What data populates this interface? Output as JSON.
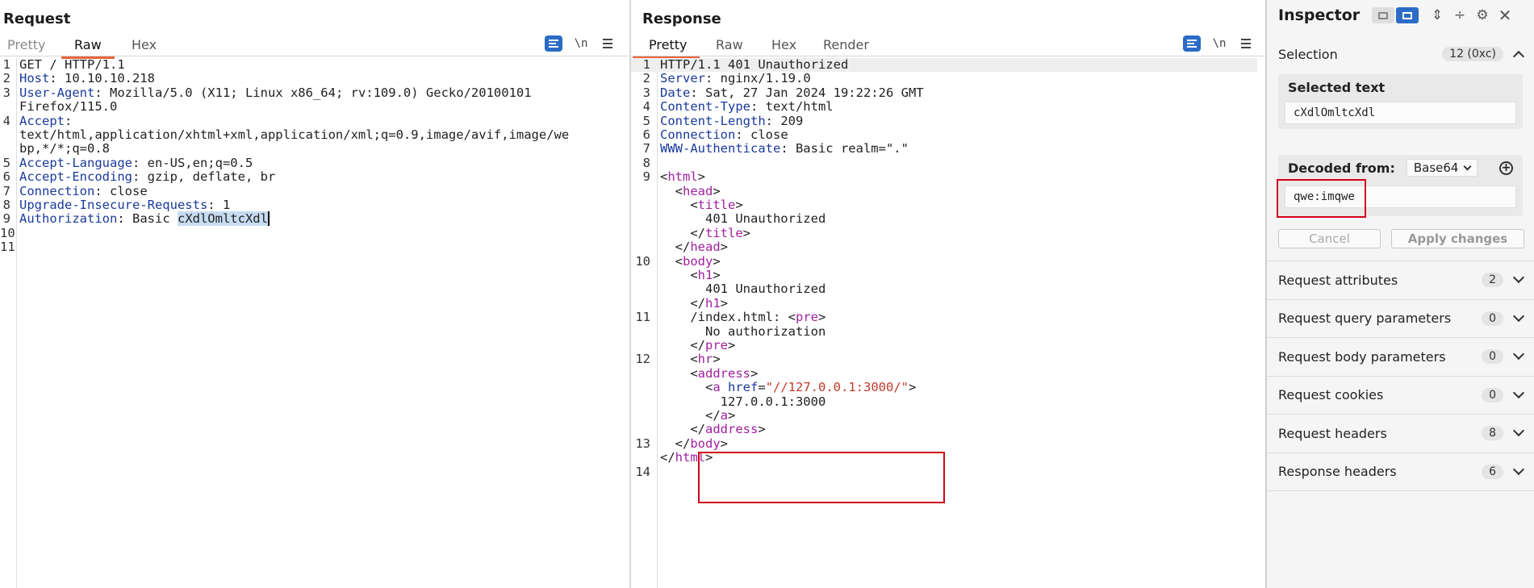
{
  "request": {
    "title": "Request",
    "tabs": [
      "Pretty",
      "Raw",
      "Hex"
    ],
    "active_tab": "Raw",
    "newline_toggle": "\\n",
    "lines": [
      {
        "n": "1",
        "key": "",
        "val": "GET / HTTP/1.1"
      },
      {
        "n": "2",
        "key": "Host",
        "val": ": 10.10.10.218"
      },
      {
        "n": "3",
        "key": "User-Agent",
        "val": ": Mozilla/5.0 (X11; Linux x86_64; rv:109.0) Gecko/20100101"
      },
      {
        "n": "",
        "key": "",
        "val": "Firefox/115.0"
      },
      {
        "n": "4",
        "key": "Accept",
        "val": ":"
      },
      {
        "n": "",
        "key": "",
        "val": "text/html,application/xhtml+xml,application/xml;q=0.9,image/avif,image/we"
      },
      {
        "n": "",
        "key": "",
        "val": "bp,*/*;q=0.8"
      },
      {
        "n": "5",
        "key": "Accept-Language",
        "val": ": en-US,en;q=0.5"
      },
      {
        "n": "6",
        "key": "Accept-Encoding",
        "val": ": gzip, deflate, br"
      },
      {
        "n": "7",
        "key": "Connection",
        "val": ": close"
      },
      {
        "n": "8",
        "key": "Upgrade-Insecure-Requests",
        "val": ": 1"
      },
      {
        "n": "9",
        "key": "Authorization",
        "val": ": Basic ",
        "sel": "cXdlOmltcXdl"
      },
      {
        "n": "10",
        "key": "",
        "val": ""
      },
      {
        "n": "11",
        "key": "",
        "val": ""
      }
    ]
  },
  "response": {
    "title": "Response",
    "tabs": [
      "Pretty",
      "Raw",
      "Hex",
      "Render"
    ],
    "active_tab": "Pretty",
    "newline_toggle": "\\n",
    "lines": [
      {
        "n": "1",
        "parts": [
          [
            "t",
            "HTTP/1.1 401 Unauthorized"
          ]
        ],
        "hl": true
      },
      {
        "n": "2",
        "parts": [
          [
            "k",
            "Server"
          ],
          [
            "t",
            ": nginx/1.19.0"
          ]
        ]
      },
      {
        "n": "3",
        "parts": [
          [
            "k",
            "Date"
          ],
          [
            "t",
            ": Sat, 27 Jan 2024 19:22:26 GMT"
          ]
        ]
      },
      {
        "n": "4",
        "parts": [
          [
            "k",
            "Content-Type"
          ],
          [
            "t",
            ": text/html"
          ]
        ]
      },
      {
        "n": "5",
        "parts": [
          [
            "k",
            "Content-Length"
          ],
          [
            "t",
            ": 209"
          ]
        ]
      },
      {
        "n": "6",
        "parts": [
          [
            "k",
            "Connection"
          ],
          [
            "t",
            ": close"
          ]
        ]
      },
      {
        "n": "7",
        "parts": [
          [
            "k",
            "WWW-Authenticate"
          ],
          [
            "t",
            ": Basic realm=\".\""
          ]
        ]
      },
      {
        "n": "8",
        "parts": []
      },
      {
        "n": "9",
        "parts": [
          [
            "t",
            "<"
          ],
          [
            "g",
            "html"
          ],
          [
            "t",
            ">"
          ]
        ]
      },
      {
        "n": "",
        "parts": [
          [
            "t",
            "  <"
          ],
          [
            "g",
            "head"
          ],
          [
            "t",
            ">"
          ]
        ]
      },
      {
        "n": "",
        "parts": [
          [
            "t",
            "    <"
          ],
          [
            "g",
            "title"
          ],
          [
            "t",
            ">"
          ]
        ]
      },
      {
        "n": "",
        "parts": [
          [
            "t",
            "      401 Unauthorized"
          ]
        ]
      },
      {
        "n": "",
        "parts": [
          [
            "t",
            "    </"
          ],
          [
            "g",
            "title"
          ],
          [
            "t",
            ">"
          ]
        ]
      },
      {
        "n": "",
        "parts": [
          [
            "t",
            "  </"
          ],
          [
            "g",
            "head"
          ],
          [
            "t",
            ">"
          ]
        ]
      },
      {
        "n": "10",
        "parts": [
          [
            "t",
            "  <"
          ],
          [
            "g",
            "body"
          ],
          [
            "t",
            ">"
          ]
        ]
      },
      {
        "n": "",
        "parts": [
          [
            "t",
            "    <"
          ],
          [
            "g",
            "h1"
          ],
          [
            "t",
            ">"
          ]
        ]
      },
      {
        "n": "",
        "parts": [
          [
            "t",
            "      401 Unauthorized"
          ]
        ]
      },
      {
        "n": "",
        "parts": [
          [
            "t",
            "    </"
          ],
          [
            "g",
            "h1"
          ],
          [
            "t",
            ">"
          ]
        ]
      },
      {
        "n": "11",
        "parts": [
          [
            "t",
            "    /index.html: <"
          ],
          [
            "g",
            "pre"
          ],
          [
            "t",
            ">"
          ]
        ]
      },
      {
        "n": "",
        "parts": [
          [
            "t",
            "      No authorization"
          ]
        ]
      },
      {
        "n": "",
        "parts": [
          [
            "t",
            "    </"
          ],
          [
            "g",
            "pre"
          ],
          [
            "t",
            ">"
          ]
        ]
      },
      {
        "n": "12",
        "parts": [
          [
            "t",
            "    <"
          ],
          [
            "g",
            "hr"
          ],
          [
            "t",
            ">"
          ]
        ]
      },
      {
        "n": "",
        "parts": [
          [
            "t",
            "    <"
          ],
          [
            "g",
            "address"
          ],
          [
            "t",
            ">"
          ]
        ]
      },
      {
        "n": "",
        "parts": [
          [
            "t",
            "      <"
          ],
          [
            "g",
            "a"
          ],
          [
            "t",
            " "
          ],
          [
            "k",
            "href"
          ],
          [
            "t",
            "="
          ],
          [
            "s",
            "\"//127.0.0.1:3000/\""
          ],
          [
            "t",
            ">"
          ]
        ]
      },
      {
        "n": "",
        "parts": [
          [
            "t",
            "        127.0.0.1:3000"
          ]
        ]
      },
      {
        "n": "",
        "parts": [
          [
            "t",
            "      </"
          ],
          [
            "g",
            "a"
          ],
          [
            "t",
            ">"
          ]
        ]
      },
      {
        "n": "",
        "parts": [
          [
            "t",
            "    </"
          ],
          [
            "g",
            "address"
          ],
          [
            "t",
            ">"
          ]
        ]
      },
      {
        "n": "13",
        "parts": [
          [
            "t",
            "  </"
          ],
          [
            "g",
            "body"
          ],
          [
            "t",
            ">"
          ]
        ]
      },
      {
        "n": "",
        "parts": [
          [
            "t",
            "</"
          ],
          [
            "g",
            "html"
          ],
          [
            "t",
            ">"
          ]
        ]
      },
      {
        "n": "14",
        "parts": []
      }
    ]
  },
  "inspector": {
    "title": "Inspector",
    "selection": {
      "label": "Selection",
      "value": "12 (0xc)"
    },
    "selected_text": {
      "header": "Selected text",
      "value": "cXdlOmltcXdl"
    },
    "decoded": {
      "header": "Decoded from:",
      "encoding": "Base64",
      "value": "qwe:imqwe"
    },
    "cancel_label": "Cancel",
    "apply_label": "Apply changes",
    "sections": [
      {
        "label": "Request attributes",
        "count": "2"
      },
      {
        "label": "Request query parameters",
        "count": "0"
      },
      {
        "label": "Request body parameters",
        "count": "0"
      },
      {
        "label": "Request cookies",
        "count": "0"
      },
      {
        "label": "Request headers",
        "count": "8"
      },
      {
        "label": "Response headers",
        "count": "6"
      }
    ]
  },
  "icons": {
    "wrap": "wrap-lines-icon",
    "menu": "hamburger-menu-icon",
    "settings": "gear-icon",
    "close": "close-icon",
    "expand": "expand-icon",
    "collapse": "collapse-icon",
    "add": "plus-circle-icon"
  },
  "colors": {
    "accent": "#2a6cc6",
    "tab_underline": "#e8643c",
    "highlight_box": "#d0021b"
  }
}
